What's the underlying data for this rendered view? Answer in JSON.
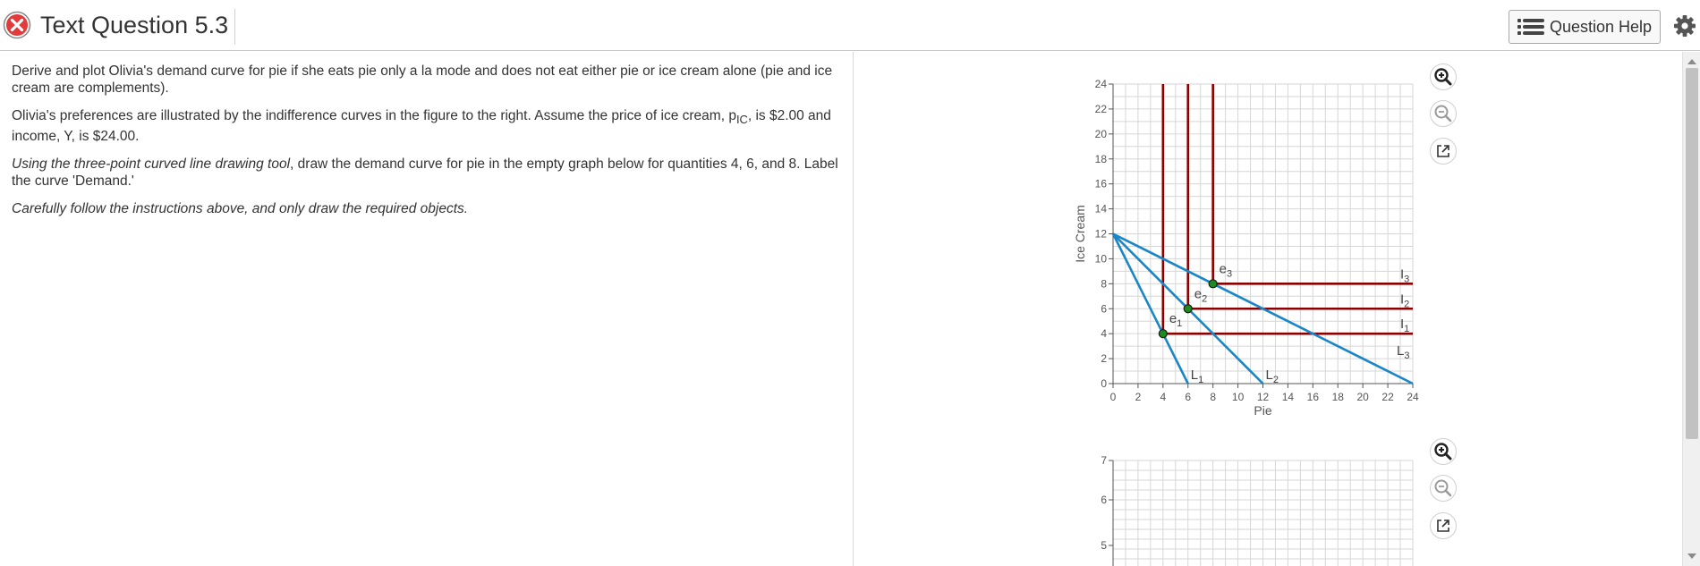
{
  "header": {
    "title": "Text Question 5.3",
    "help_label": "Question Help"
  },
  "question": {
    "para1": "Derive and plot Olivia's demand curve for pie if she eats pie only a la mode and does not eat either pie or ice cream alone (pie and ice cream are complements).",
    "para2_a": "Olivia's preferences are illustrated by the indifference curves in the figure to the right.  Assume the price of ice cream, p",
    "para2_sub": "IC",
    "para2_b": ", is $2.00 and income, Y, is $24.00.",
    "para3_italic": "Using the three-point curved line drawing tool",
    "para3_rest": ", draw the demand curve for pie in the empty graph below for quantities 4, 6, and 8. Label the curve 'Demand.'",
    "para4": "Carefully follow the instructions above, and only draw the required objects."
  },
  "chart_data": [
    {
      "type": "line",
      "xlabel": "Pie",
      "ylabel": "Ice Cream",
      "xlim": [
        0,
        24
      ],
      "ylim": [
        0,
        24
      ],
      "xticks": [
        0,
        2,
        4,
        6,
        8,
        10,
        12,
        14,
        16,
        18,
        20,
        22,
        24
      ],
      "yticks": [
        0,
        2,
        4,
        6,
        8,
        10,
        12,
        14,
        16,
        18,
        20,
        22,
        24
      ],
      "grid": true,
      "budget_lines": [
        {
          "name": "L1",
          "x": [
            0,
            6
          ],
          "y": [
            12,
            0
          ]
        },
        {
          "name": "L2",
          "x": [
            0,
            12
          ],
          "y": [
            12,
            0
          ]
        },
        {
          "name": "L3",
          "x": [
            0,
            24
          ],
          "y": [
            12,
            0
          ]
        }
      ],
      "indifference_curves": [
        {
          "name": "I1",
          "corner": [
            4,
            4
          ]
        },
        {
          "name": "I2",
          "corner": [
            6,
            6
          ]
        },
        {
          "name": "I3",
          "corner": [
            8,
            8
          ]
        }
      ],
      "equilibria": [
        {
          "name": "e1",
          "x": 4,
          "y": 4
        },
        {
          "name": "e2",
          "x": 6,
          "y": 6
        },
        {
          "name": "e3",
          "x": 8,
          "y": 8
        }
      ],
      "colors": {
        "budget": "#1a86c8",
        "indifference": "#8b0000",
        "point": "#1f8a1f"
      }
    },
    {
      "type": "line",
      "xlabel": "",
      "ylabel": "",
      "yticks_visible": [
        5,
        6,
        7
      ],
      "grid": true
    }
  ]
}
